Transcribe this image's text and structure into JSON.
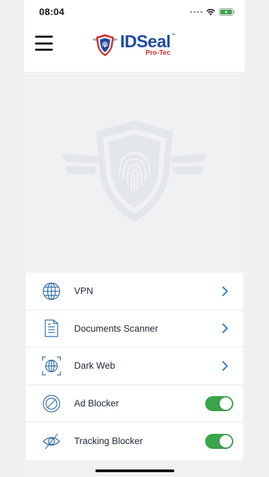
{
  "status_bar": {
    "time": "08:04",
    "battery_color": "#3aa54a"
  },
  "header": {
    "menu_icon": "hamburger-icon",
    "logo": {
      "brand": "IDSeal",
      "trademark": "™",
      "sub": "Pro-Tec"
    }
  },
  "hero": {
    "icon": "shield-fingerprint-watermark"
  },
  "menu": {
    "items": [
      {
        "label": "VPN",
        "icon": "globe-icon",
        "control": "chevron"
      },
      {
        "label": "Documents Scanner",
        "icon": "document-icon",
        "control": "chevron"
      },
      {
        "label": "Dark Web",
        "icon": "globe-scan-icon",
        "control": "chevron"
      },
      {
        "label": "Ad Blocker",
        "icon": "block-icon",
        "control": "toggle",
        "enabled": true
      },
      {
        "label": "Tracking Blocker",
        "icon": "eye-slash-icon",
        "control": "toggle",
        "enabled": true
      }
    ]
  },
  "colors": {
    "accent": "#2d7ec3",
    "toggle_on": "#3aa54a",
    "brand_blue": "#1f4aa0",
    "brand_red": "#d32f2f"
  }
}
